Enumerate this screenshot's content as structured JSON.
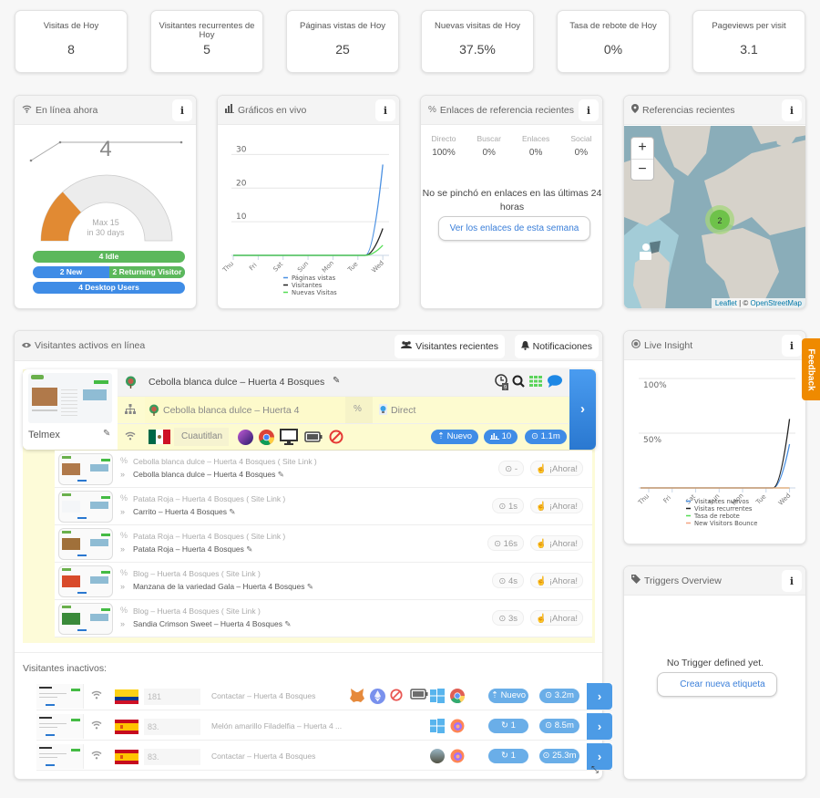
{
  "stats": [
    {
      "label": "Visitas de Hoy",
      "value": "8"
    },
    {
      "label": "Visitantes recurrentes de Hoy",
      "value": "5"
    },
    {
      "label": "Páginas vistas de Hoy",
      "value": "25"
    },
    {
      "label": "Nuevas visitas de Hoy",
      "value": "37.5%"
    },
    {
      "label": "Tasa de rebote de Hoy",
      "value": "0%"
    },
    {
      "label": "Pageviews per visit",
      "value": "3.1"
    }
  ],
  "online": {
    "title": "En línea ahora",
    "count": "4",
    "gauge_value": 4,
    "gauge_max": 15,
    "gauge_caption_1": "Max 15",
    "gauge_caption_2": "in 30 days",
    "idle": "4 Idle",
    "new": "2 New",
    "returning": "2 Returning Visitor",
    "desktop": "4 Desktop Users",
    "info": "i"
  },
  "live_charts": {
    "title": "Gráficos en vivo",
    "info": "i",
    "chart_data": {
      "type": "line",
      "categories": [
        "Thu",
        "Fri",
        "Sat",
        "Sun",
        "Mon",
        "Tue",
        "Wed"
      ],
      "series": [
        {
          "name": "Páginas vistas",
          "color": "#4a90e2",
          "values": [
            0,
            0,
            0,
            0,
            0,
            0,
            27
          ]
        },
        {
          "name": "Visitantes",
          "color": "#222222",
          "values": [
            0,
            0,
            0,
            0,
            0,
            0,
            8
          ]
        },
        {
          "name": "Nuevas Visitas",
          "color": "#55dd55",
          "values": [
            0,
            0,
            0,
            0,
            0,
            0,
            3
          ]
        }
      ],
      "yticks": [
        "10",
        "20",
        "30"
      ],
      "ylim": [
        0,
        32
      ]
    }
  },
  "referral": {
    "title": "Enlaces de referencia recientes",
    "info": "i",
    "columns": [
      {
        "label": "Directo",
        "value": "100%"
      },
      {
        "label": "Buscar",
        "value": "0%"
      },
      {
        "label": "Enlaces",
        "value": "0%"
      },
      {
        "label": "Social",
        "value": "0%"
      }
    ],
    "message": "No se pinchó en enlaces en las últimas 24 horas",
    "button": "Ver los enlaces de esta semana"
  },
  "map": {
    "title": "Referencias recientes",
    "info": "i",
    "zoom_in": "+",
    "zoom_out": "−",
    "cluster": "2",
    "attribution_leaflet": "Leaflet",
    "attribution_sep": " | © ",
    "attribution_osm": "OpenStreetMap"
  },
  "active": {
    "title": "Visitantes activos en línea",
    "recent_btn": "Visitantes recientes",
    "notif_btn": "Notificaciones",
    "visitor": {
      "isp": "Telmex",
      "page_title": "Cebolla blanca dulce – Huerta 4 Bosques",
      "entry_page": "Cebolla blanca dulce – Huerta 4",
      "referrer": "Direct",
      "city": "Cuautitlan",
      "status": "Nuevo",
      "pageviews": "10",
      "duration": "1.1m",
      "history_badge": "9"
    },
    "history": [
      {
        "from": "Cebolla blanca dulce – Huerta 4 Bosques ( Site Link )",
        "page": "Cebolla blanca dulce – Huerta 4 Bosques",
        "time": "-",
        "now": "¡Ahora!"
      },
      {
        "from": "Patata Roja – Huerta 4 Bosques ( Site Link )",
        "page": "Carrito – Huerta 4 Bosques",
        "time": "1s",
        "now": "¡Ahora!"
      },
      {
        "from": "Patata Roja – Huerta 4 Bosques ( Site Link )",
        "page": "Patata Roja – Huerta 4 Bosques",
        "time": "16s",
        "now": "¡Ahora!"
      },
      {
        "from": "Blog – Huerta 4 Bosques ( Site Link )",
        "page": "Manzana de la variedad Gala – Huerta 4 Bosques",
        "time": "4s",
        "now": "¡Ahora!"
      },
      {
        "from": "Blog – Huerta 4 Bosques ( Site Link )",
        "page": "Sandia Crimson Sweet – Huerta 4 Bosques",
        "time": "3s",
        "now": "¡Ahora!"
      }
    ],
    "inactive_title": "Visitantes inactivos:",
    "inactive": [
      {
        "ip": "181",
        "page": "Contactar – Huerta 4 Bosques",
        "badge": "Nuevo",
        "duration": "3.2m",
        "country": "colombia"
      },
      {
        "ip": "83.",
        "page": "Melón amarillo Filadelfia – Huerta 4 ...",
        "badge": "1",
        "duration": "8.5m",
        "country": "spain"
      },
      {
        "ip": "83.",
        "page": "Contactar – Huerta 4 Bosques",
        "badge": "1",
        "duration": "25.3m",
        "country": "spain"
      }
    ]
  },
  "live_insight": {
    "title": "Live Insight",
    "info": "i",
    "chart_data": {
      "type": "line",
      "categories": [
        "Thu",
        "Fri",
        "Sat",
        "Sun",
        "Mon",
        "Tue",
        "Wed"
      ],
      "series": [
        {
          "name": "Visitantes nuevos",
          "color": "#4a90e2",
          "values": [
            0,
            0,
            0,
            0,
            0,
            0,
            40
          ]
        },
        {
          "name": "Visitas recurrentes",
          "color": "#222222",
          "values": [
            0,
            0,
            0,
            0,
            0,
            0,
            63
          ]
        },
        {
          "name": "Tasa de rebote",
          "color": "#55dd55",
          "values": [
            0,
            0,
            0,
            0,
            0,
            0,
            0
          ]
        },
        {
          "name": "New Visitors Bounce",
          "color": "#f4a582",
          "values": [
            0,
            0,
            0,
            0,
            0,
            0,
            0
          ]
        }
      ],
      "yticks": [
        "50%",
        "100%"
      ],
      "ylim": [
        0,
        100
      ]
    }
  },
  "triggers": {
    "title": "Triggers Overview",
    "info": "i",
    "message": "No Trigger defined yet.",
    "button": "Crear nueva etiqueta"
  },
  "feedback": "Feedback"
}
